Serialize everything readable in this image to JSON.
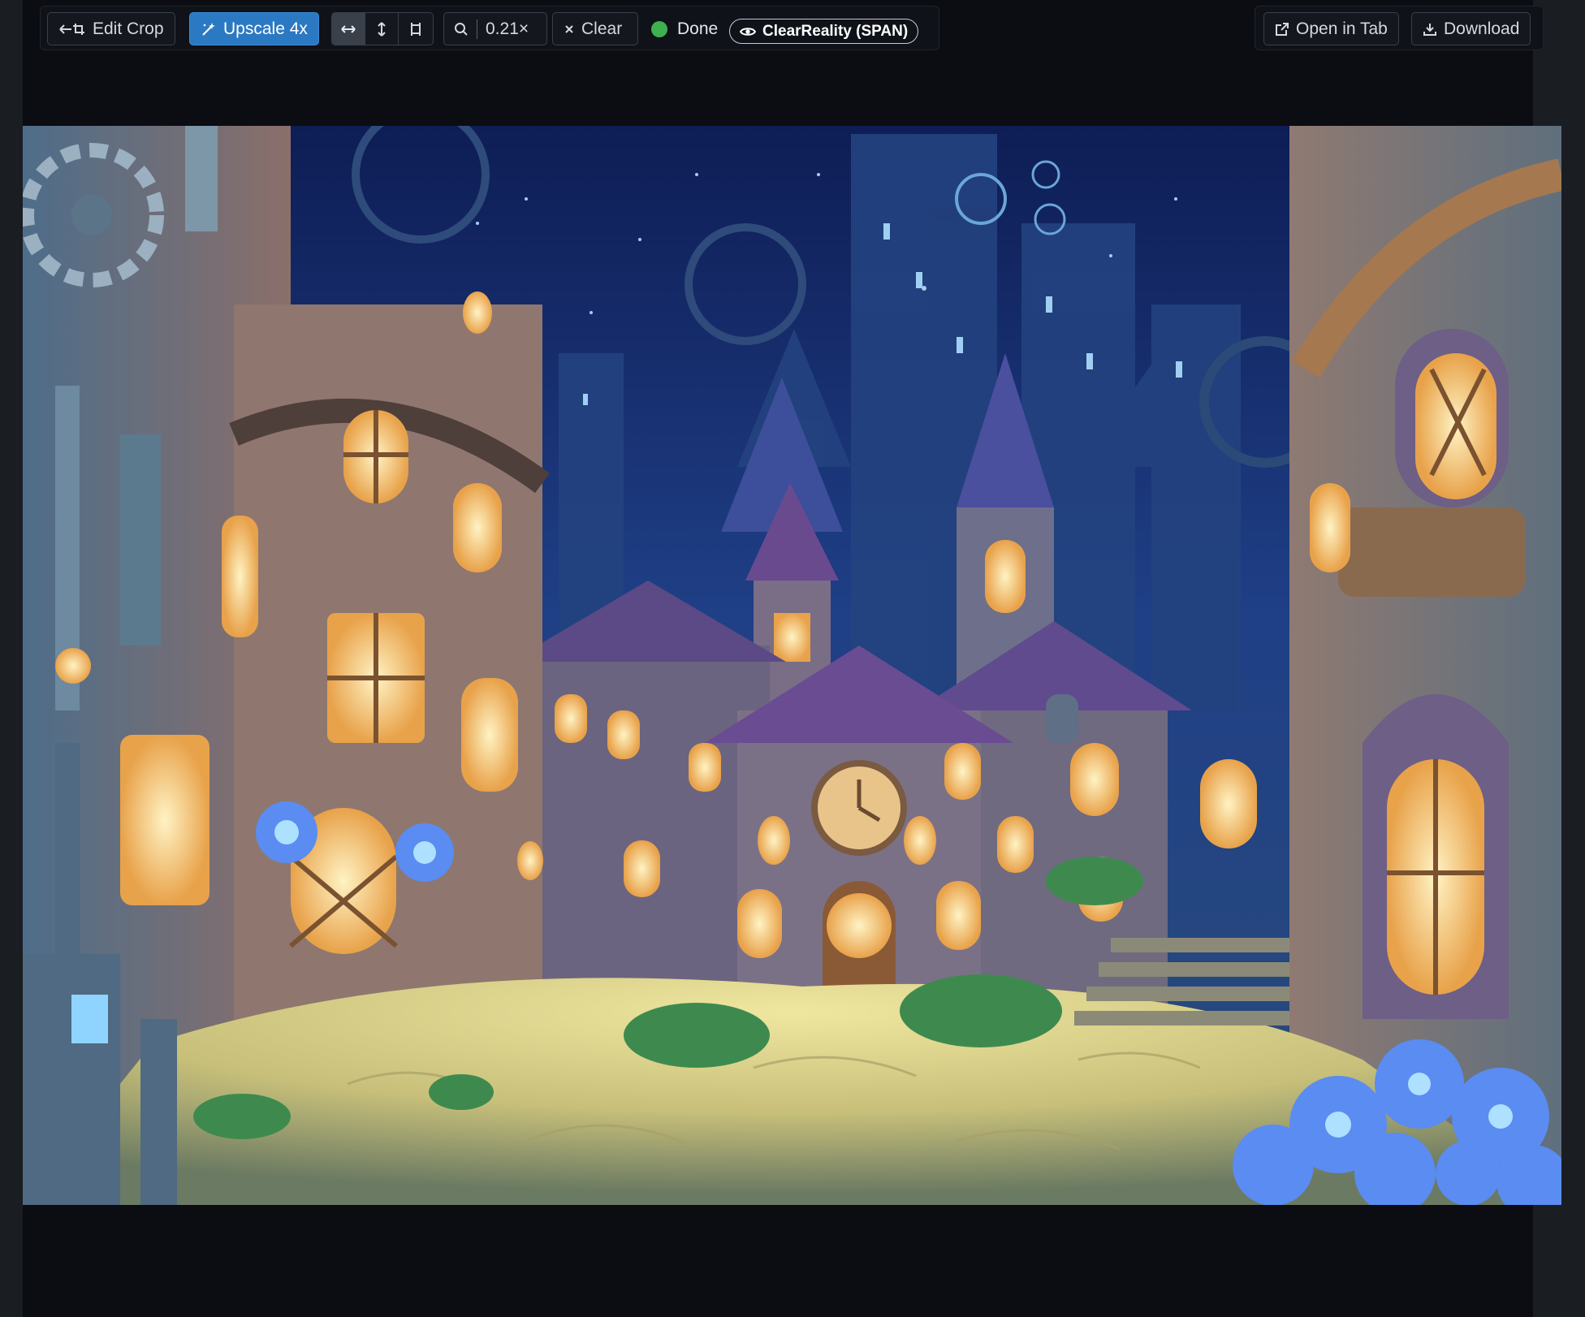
{
  "toolbar": {
    "edit_crop_label": "Edit Crop",
    "upscale_label": "Upscale 4x",
    "fit_modes": [
      "fit-width",
      "fit-height",
      "fit-actual"
    ],
    "active_fit_mode": "fit-width",
    "zoom_value": "0.21×",
    "clear_label": "Clear",
    "status_text": "Done",
    "status_color": "#3fb04f",
    "model_label": "ClearReality (SPAN)",
    "open_tab_label": "Open in Tab",
    "download_label": "Download"
  },
  "colors": {
    "background": "#0b0d12",
    "accent": "#2b79c2",
    "button_border": "#3a4049"
  },
  "icons": {
    "edit_crop": "crop-back-icon",
    "upscale": "magic-wand-icon",
    "zoom": "search-icon",
    "clear": "close-icon",
    "model": "eye-icon",
    "open_tab": "external-link-icon",
    "download": "download-icon"
  }
}
